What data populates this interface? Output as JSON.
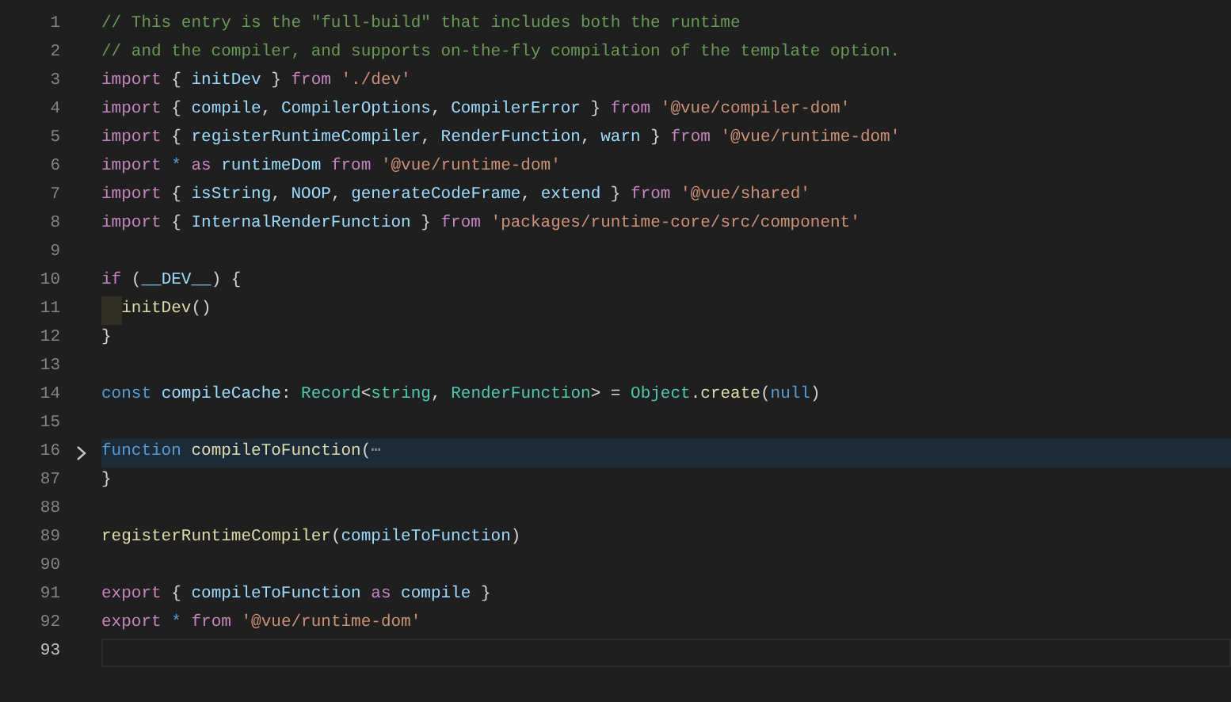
{
  "editor": {
    "lines": [
      {
        "number": "1",
        "tokens": [
          {
            "kind": "comment",
            "text": "// This entry is the \"full-build\" that includes both the runtime"
          }
        ]
      },
      {
        "number": "2",
        "tokens": [
          {
            "kind": "comment",
            "text": "// and the compiler, and supports on-the-fly compilation of the template option."
          }
        ]
      },
      {
        "number": "3",
        "tokens": [
          {
            "kind": "keyword",
            "text": "import"
          },
          {
            "kind": "punctuation",
            "text": " { "
          },
          {
            "kind": "variable",
            "text": "initDev"
          },
          {
            "kind": "punctuation",
            "text": " } "
          },
          {
            "kind": "keyword",
            "text": "from "
          },
          {
            "kind": "string",
            "text": "'./dev'"
          }
        ]
      },
      {
        "number": "4",
        "tokens": [
          {
            "kind": "keyword",
            "text": "import"
          },
          {
            "kind": "punctuation",
            "text": " { "
          },
          {
            "kind": "variable",
            "text": "compile"
          },
          {
            "kind": "punctuation",
            "text": ", "
          },
          {
            "kind": "variable",
            "text": "CompilerOptions"
          },
          {
            "kind": "punctuation",
            "text": ", "
          },
          {
            "kind": "variable",
            "text": "CompilerError"
          },
          {
            "kind": "punctuation",
            "text": " } "
          },
          {
            "kind": "keyword",
            "text": "from "
          },
          {
            "kind": "string",
            "text": "'@vue/compiler-dom'"
          }
        ]
      },
      {
        "number": "5",
        "tokens": [
          {
            "kind": "keyword",
            "text": "import"
          },
          {
            "kind": "punctuation",
            "text": " { "
          },
          {
            "kind": "variable",
            "text": "registerRuntimeCompiler"
          },
          {
            "kind": "punctuation",
            "text": ", "
          },
          {
            "kind": "variable",
            "text": "RenderFunction"
          },
          {
            "kind": "punctuation",
            "text": ", "
          },
          {
            "kind": "variable",
            "text": "warn"
          },
          {
            "kind": "punctuation",
            "text": " } "
          },
          {
            "kind": "keyword",
            "text": "from "
          },
          {
            "kind": "string",
            "text": "'@vue/runtime-dom'"
          }
        ]
      },
      {
        "number": "6",
        "tokens": [
          {
            "kind": "keyword",
            "text": "import "
          },
          {
            "kind": "storage",
            "text": "* "
          },
          {
            "kind": "keyword",
            "text": "as "
          },
          {
            "kind": "variable",
            "text": "runtimeDom "
          },
          {
            "kind": "keyword",
            "text": "from "
          },
          {
            "kind": "string",
            "text": "'@vue/runtime-dom'"
          }
        ]
      },
      {
        "number": "7",
        "tokens": [
          {
            "kind": "keyword",
            "text": "import"
          },
          {
            "kind": "punctuation",
            "text": " { "
          },
          {
            "kind": "variable",
            "text": "isString"
          },
          {
            "kind": "punctuation",
            "text": ", "
          },
          {
            "kind": "variable",
            "text": "NOOP"
          },
          {
            "kind": "punctuation",
            "text": ", "
          },
          {
            "kind": "variable",
            "text": "generateCodeFrame"
          },
          {
            "kind": "punctuation",
            "text": ", "
          },
          {
            "kind": "variable",
            "text": "extend"
          },
          {
            "kind": "punctuation",
            "text": " } "
          },
          {
            "kind": "keyword",
            "text": "from "
          },
          {
            "kind": "string",
            "text": "'@vue/shared'"
          }
        ]
      },
      {
        "number": "8",
        "tokens": [
          {
            "kind": "keyword",
            "text": "import"
          },
          {
            "kind": "punctuation",
            "text": " { "
          },
          {
            "kind": "variable",
            "text": "InternalRenderFunction"
          },
          {
            "kind": "punctuation",
            "text": " } "
          },
          {
            "kind": "keyword",
            "text": "from "
          },
          {
            "kind": "string",
            "text": "'packages/runtime-core/src/component'"
          }
        ]
      },
      {
        "number": "9"
      },
      {
        "number": "10",
        "tokens": [
          {
            "kind": "keyword",
            "text": "if"
          },
          {
            "kind": "punctuation",
            "text": " ("
          },
          {
            "kind": "variable",
            "text": "__DEV__"
          },
          {
            "kind": "punctuation",
            "text": ") {"
          }
        ]
      },
      {
        "number": "11",
        "guide_active": true,
        "tokens": [
          {
            "kind": "function",
            "text": "initDev"
          },
          {
            "kind": "punctuation",
            "text": "()"
          }
        ]
      },
      {
        "number": "12",
        "tokens": [
          {
            "kind": "punctuation",
            "text": "}"
          }
        ]
      },
      {
        "number": "13"
      },
      {
        "number": "14",
        "tokens": [
          {
            "kind": "storage",
            "text": "const "
          },
          {
            "kind": "variable",
            "text": "compileCache"
          },
          {
            "kind": "punctuation",
            "text": ": "
          },
          {
            "kind": "type",
            "text": "Record"
          },
          {
            "kind": "punctuation",
            "text": "<"
          },
          {
            "kind": "type",
            "text": "string"
          },
          {
            "kind": "punctuation",
            "text": ", "
          },
          {
            "kind": "type",
            "text": "RenderFunction"
          },
          {
            "kind": "punctuation",
            "text": "> = "
          },
          {
            "kind": "type",
            "text": "Object"
          },
          {
            "kind": "punctuation",
            "text": "."
          },
          {
            "kind": "function",
            "text": "create"
          },
          {
            "kind": "punctuation",
            "text": "("
          },
          {
            "kind": "storage",
            "text": "null"
          },
          {
            "kind": "punctuation",
            "text": ")"
          }
        ]
      },
      {
        "number": "15"
      },
      {
        "number": "16",
        "folded": true,
        "tokens": [
          {
            "kind": "storage",
            "text": "function "
          },
          {
            "kind": "function",
            "text": "compileToFunction"
          },
          {
            "kind": "punctuation",
            "text": "("
          },
          {
            "kind": "fold",
            "text": "⋯"
          }
        ]
      },
      {
        "number": "87",
        "tokens": [
          {
            "kind": "punctuation",
            "text": "}"
          }
        ]
      },
      {
        "number": "88"
      },
      {
        "number": "89",
        "tokens": [
          {
            "kind": "function",
            "text": "registerRuntimeCompiler"
          },
          {
            "kind": "punctuation",
            "text": "("
          },
          {
            "kind": "variable",
            "text": "compileToFunction"
          },
          {
            "kind": "punctuation",
            "text": ")"
          }
        ]
      },
      {
        "number": "90"
      },
      {
        "number": "91",
        "tokens": [
          {
            "kind": "keyword",
            "text": "export"
          },
          {
            "kind": "punctuation",
            "text": " { "
          },
          {
            "kind": "variable",
            "text": "compileToFunction "
          },
          {
            "kind": "keyword",
            "text": "as "
          },
          {
            "kind": "variable",
            "text": "compile"
          },
          {
            "kind": "punctuation",
            "text": " }"
          }
        ]
      },
      {
        "number": "92",
        "tokens": [
          {
            "kind": "keyword",
            "text": "export "
          },
          {
            "kind": "storage",
            "text": "* "
          },
          {
            "kind": "keyword",
            "text": "from "
          },
          {
            "kind": "string",
            "text": "'@vue/runtime-dom'"
          }
        ]
      },
      {
        "number": "93",
        "current": true
      }
    ]
  }
}
